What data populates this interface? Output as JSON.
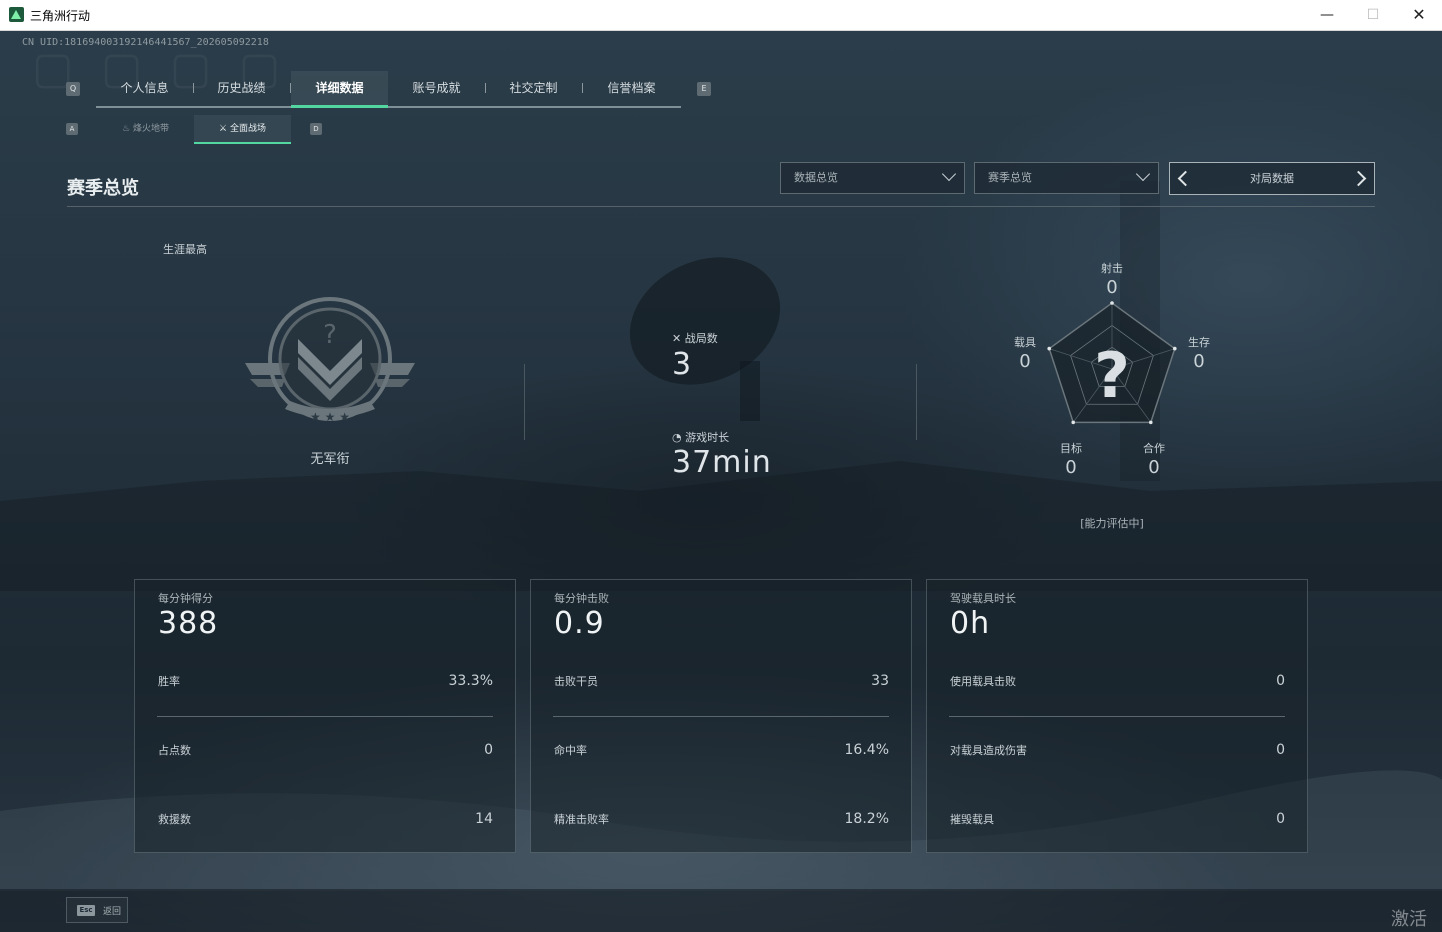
{
  "window": {
    "title": "三角洲行动",
    "min_glyph": "—",
    "max_glyph": "☐",
    "close_glyph": "✕"
  },
  "uid_text": "CN UID:18169400319214644156­7_202605092218",
  "main_tabs": {
    "left_key": "Q",
    "right_key": "E",
    "items": [
      {
        "label": "个人信息"
      },
      {
        "label": "历史战绩"
      },
      {
        "label": "详细数据",
        "active": true
      },
      {
        "label": "账号成就"
      },
      {
        "label": "社交定制"
      },
      {
        "label": "信誉档案"
      }
    ]
  },
  "sub_tabs": {
    "left_key": "A",
    "right_key": "D",
    "items": [
      {
        "label": "烽火地带",
        "icon": "flame-icon"
      },
      {
        "label": "全面战场",
        "icon": "crossed-arrows-icon",
        "active": true
      }
    ]
  },
  "header": {
    "title": "赛季总览",
    "dropdown_1": "数据总览",
    "dropdown_2": "赛季总览",
    "pager_label": "对局数据"
  },
  "rank": {
    "career_label": "生涯最高",
    "name": "无军衔",
    "badge_glyph": "?"
  },
  "summary": {
    "matches_label": "战局数",
    "matches_value": "3",
    "playtime_label": "游戏时长",
    "playtime_value": "37min"
  },
  "radar": {
    "center_glyph": "?",
    "status": "[能力评估中]",
    "axes": [
      {
        "label": "射击",
        "value": 0
      },
      {
        "label": "生存",
        "value": 0
      },
      {
        "label": "合作",
        "value": 0
      },
      {
        "label": "目标",
        "value": 0
      },
      {
        "label": "载具",
        "value": 0
      }
    ]
  },
  "cards": [
    {
      "head": "每分钟得分",
      "big": "388",
      "rows": [
        {
          "label": "胜率",
          "value": "33.3%"
        },
        {
          "label": "占点数",
          "value": "0"
        },
        {
          "label": "救援数",
          "value": "14"
        }
      ]
    },
    {
      "head": "每分钟击败",
      "big": "0.9",
      "rows": [
        {
          "label": "击败干员",
          "value": "33"
        },
        {
          "label": "命中率",
          "value": "16.4%"
        },
        {
          "label": "精准击败率",
          "value": "18.2%"
        }
      ]
    },
    {
      "head": "驾驶载具时长",
      "big": "0h",
      "rows": [
        {
          "label": "使用载具击败",
          "value": "0"
        },
        {
          "label": "对载具造成伤害",
          "value": "0"
        },
        {
          "label": "摧毁载具",
          "value": "0"
        }
      ]
    }
  ],
  "footer": {
    "esc_key": "Esc",
    "esc_label": "返回",
    "activate_text": "激活 W"
  },
  "colors": {
    "accent": "#53d6a0",
    "background": "#1f2c37",
    "text": "#c9d2d6"
  }
}
